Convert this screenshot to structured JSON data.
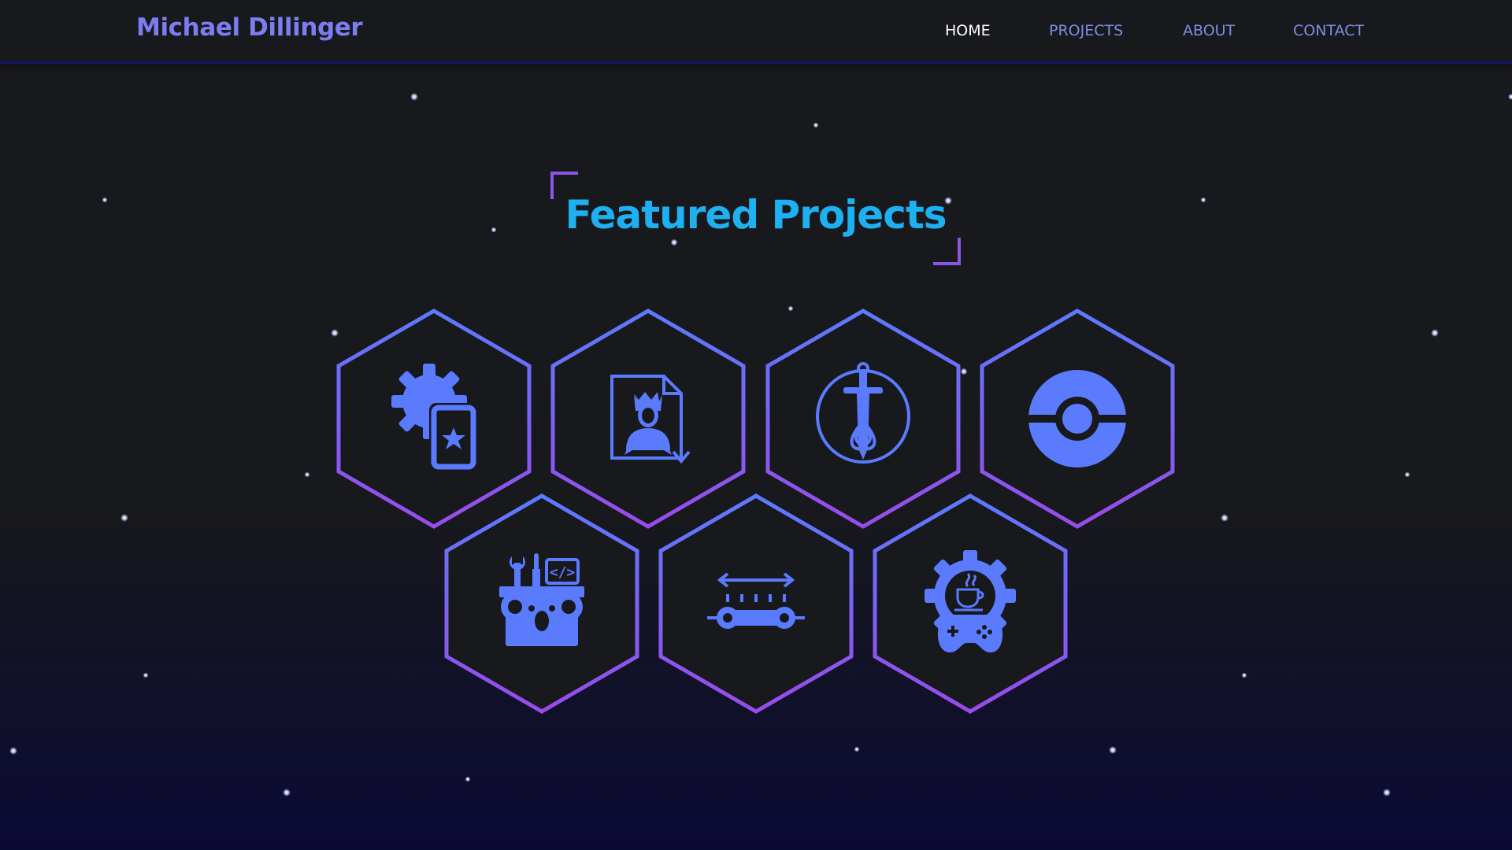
{
  "header": {
    "brand": "Michael Dillinger",
    "nav": [
      {
        "label": "HOME",
        "active": true
      },
      {
        "label": "PROJECTS",
        "active": false
      },
      {
        "label": "ABOUT",
        "active": false
      },
      {
        "label": "CONTACT",
        "active": false
      }
    ]
  },
  "featured": {
    "title": "Featured Projects"
  },
  "projects": [
    {
      "icon": "gear-card-icon"
    },
    {
      "icon": "character-sheet-download-icon"
    },
    {
      "icon": "celtic-sword-icon"
    },
    {
      "icon": "pokeball-icon"
    },
    {
      "icon": "koala-dev-tools-icon"
    },
    {
      "icon": "slider-track-icon"
    },
    {
      "icon": "java-gear-gamepad-icon"
    }
  ],
  "colors": {
    "background": "#18191c",
    "background_bottom": "#0b0a35",
    "brand": "#7b7df0",
    "nav": "#7e8de3",
    "nav_active": "#ffffff",
    "title": "#1eb1f2",
    "icon": "#5b7bff",
    "hex_gradient_top": "#5b7bff",
    "hex_gradient_bottom": "#9a4bec",
    "corner_bracket": "#8a56e8"
  }
}
